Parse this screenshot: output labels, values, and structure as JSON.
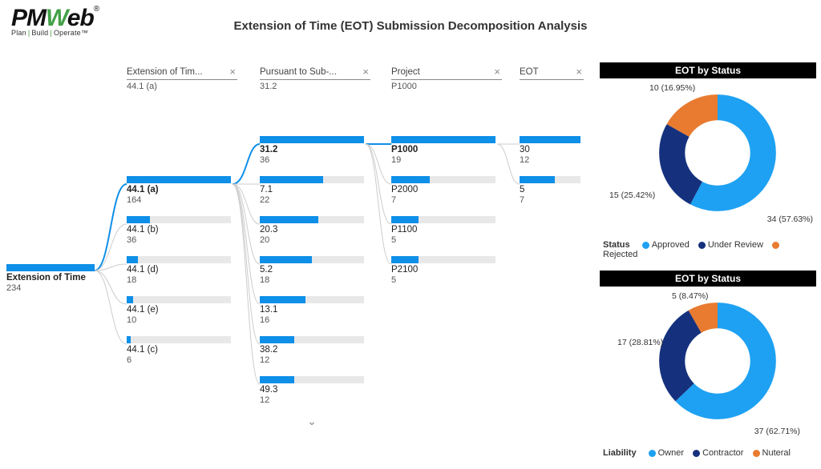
{
  "brand": {
    "name_part1": "PM",
    "name_w": "W",
    "name_part2": "eb",
    "reg": "®",
    "tag1": "Plan",
    "tag2": "Build",
    "tag3": "Operate",
    "tm": "™"
  },
  "title": "Extension of Time (EOT) Submission Decomposition Analysis",
  "decomp": {
    "root": {
      "label": "Extension of Time",
      "value": "234"
    },
    "col1": {
      "header": "Extension of Tim...",
      "sub": "44.1 (a)",
      "nodes": [
        {
          "label": "44.1 (a)",
          "value": "164",
          "bold": true,
          "fill": 100
        },
        {
          "label": "44.1 (b)",
          "value": "36",
          "fill": 22
        },
        {
          "label": "44.1 (d)",
          "value": "18",
          "fill": 11
        },
        {
          "label": "44.1 (e)",
          "value": "10",
          "fill": 6
        },
        {
          "label": "44.1 (c)",
          "value": "6",
          "fill": 4
        }
      ]
    },
    "col2": {
      "header": "Pursuant to Sub-...",
      "sub": "31.2",
      "nodes": [
        {
          "label": "31.2",
          "value": "36",
          "bold": true,
          "fill": 100
        },
        {
          "label": "7.1",
          "value": "22",
          "fill": 61
        },
        {
          "label": "20.3",
          "value": "20",
          "fill": 56
        },
        {
          "label": "5.2",
          "value": "18",
          "fill": 50
        },
        {
          "label": "13.1",
          "value": "16",
          "fill": 44
        },
        {
          "label": "38.2",
          "value": "12",
          "fill": 33
        },
        {
          "label": "49.3",
          "value": "12",
          "fill": 33
        }
      ]
    },
    "col3": {
      "header": "Project",
      "sub": "P1000",
      "nodes": [
        {
          "label": "P1000",
          "value": "19",
          "bold": true,
          "fill": 100
        },
        {
          "label": "P2000",
          "value": "7",
          "fill": 37
        },
        {
          "label": "P1100",
          "value": "5",
          "fill": 26
        },
        {
          "label": "P2100",
          "value": "5",
          "fill": 26
        }
      ]
    },
    "col4": {
      "header": "EOT",
      "sub": "",
      "nodes": [
        {
          "label": "30",
          "value": "12",
          "fill": 100
        },
        {
          "label": "5",
          "value": "7",
          "fill": 58
        }
      ]
    }
  },
  "charts": {
    "panel1": {
      "title": "EOT by Status",
      "legend_key": "Status",
      "items": [
        {
          "name": "Approved",
          "value": 34,
          "pct": "57.63%",
          "color": "#1ea1f2",
          "label": "34 (57.63%)"
        },
        {
          "name": "Under Review",
          "value": 15,
          "pct": "25.42%",
          "color": "#15317e",
          "label": "15 (25.42%)"
        },
        {
          "name": "Rejected",
          "value": 10,
          "pct": "16.95%",
          "color": "#e87b2f",
          "label": "10 (16.95%)"
        }
      ]
    },
    "panel2": {
      "title": "EOT by Status",
      "legend_key": "Liability",
      "items": [
        {
          "name": "Owner",
          "value": 37,
          "pct": "62.71%",
          "color": "#1ea1f2",
          "label": "37 (62.71%)"
        },
        {
          "name": "Contractor",
          "value": 17,
          "pct": "28.81%",
          "color": "#15317e",
          "label": "17 (28.81%)"
        },
        {
          "name": "Nuteral",
          "value": 5,
          "pct": "8.47%",
          "color": "#e87b2f",
          "label": "5 (8.47%)"
        }
      ]
    }
  },
  "chart_data": [
    {
      "type": "pie",
      "title": "EOT by Status",
      "categories": [
        "Approved",
        "Under Review",
        "Rejected"
      ],
      "values": [
        34,
        15,
        10
      ],
      "percentages": [
        57.63,
        25.42,
        16.95
      ],
      "colors": [
        "#1ea1f2",
        "#15317e",
        "#e87b2f"
      ],
      "legend_key": "Status"
    },
    {
      "type": "pie",
      "title": "EOT by Status",
      "categories": [
        "Owner",
        "Contractor",
        "Nuteral"
      ],
      "values": [
        37,
        17,
        5
      ],
      "percentages": [
        62.71,
        28.81,
        8.47
      ],
      "colors": [
        "#1ea1f2",
        "#15317e",
        "#e87b2f"
      ],
      "legend_key": "Liability"
    },
    {
      "type": "bar",
      "title": "Decomposition — Root",
      "categories": [
        "Extension of Time"
      ],
      "values": [
        234
      ]
    },
    {
      "type": "bar",
      "title": "Extension of Time Sub-Clause",
      "categories": [
        "44.1 (a)",
        "44.1 (b)",
        "44.1 (d)",
        "44.1 (e)",
        "44.1 (c)"
      ],
      "values": [
        164,
        36,
        18,
        10,
        6
      ]
    },
    {
      "type": "bar",
      "title": "Pursuant to Sub-Clause",
      "categories": [
        "31.2",
        "7.1",
        "20.3",
        "5.2",
        "13.1",
        "38.2",
        "49.3"
      ],
      "values": [
        36,
        22,
        20,
        18,
        16,
        12,
        12
      ]
    },
    {
      "type": "bar",
      "title": "Project",
      "categories": [
        "P1000",
        "P2000",
        "P1100",
        "P2100"
      ],
      "values": [
        19,
        7,
        5,
        5
      ]
    },
    {
      "type": "bar",
      "title": "EOT",
      "categories": [
        "30",
        "5"
      ],
      "values": [
        12,
        7
      ]
    }
  ]
}
